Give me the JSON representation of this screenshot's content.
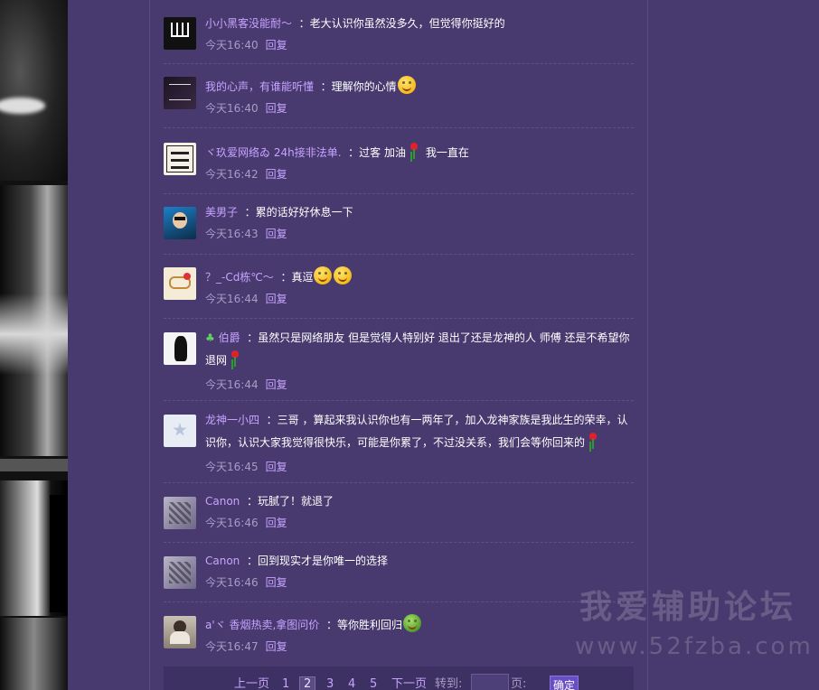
{
  "comments": [
    {
      "user": "小小黑客没能耐～",
      "text": "：老大认识你虽然没多久，但觉得你挺好的",
      "time": "今天16:40",
      "reply": "回复"
    },
    {
      "user": "我的心声，有谁能听懂",
      "text": "：理解你的心情",
      "time": "今天16:40",
      "reply": "回复"
    },
    {
      "user": "ヾ玖爱网络ゐ 24h接非法单.",
      "text": "：过客 加油",
      "text2": "我一直在",
      "time": "今天16:42",
      "reply": "回复"
    },
    {
      "user": "美男子",
      "text": "：累的话好好休息一下",
      "time": "今天16:43",
      "reply": "回复"
    },
    {
      "user": "？_-Cd栋℃～",
      "text": "：真逗",
      "time": "今天16:44",
      "reply": "回复"
    },
    {
      "user": "伯爵",
      "text": "：虽然只是网络朋友 但是觉得人特别好 退出了还是龙神的人 师傅 还是不希望你退网",
      "time": "今天16:44",
      "reply": "回复"
    },
    {
      "user": "龙神一小四",
      "text": "：三哥 ，算起来我认识你也有一两年了，加入龙神家族是我此生的荣幸，认识你，认识大家我觉得很快乐，可能是你累了，不过没关系，我们会等你回来的",
      "time": "今天16:45",
      "reply": "回复"
    },
    {
      "user": "Canon",
      "text": "：玩腻了！就退了",
      "time": "今天16:46",
      "reply": "回复"
    },
    {
      "user": "Canon",
      "text": "：回到现实才是你唯一的选择",
      "time": "今天16:46",
      "reply": "回复"
    },
    {
      "user": "a'ヾ 香烟热卖,拿图问价",
      "text": "：等你胜利回归",
      "time": "今天16:47",
      "reply": "回复"
    }
  ],
  "pager": {
    "prev": "上一页",
    "pages": [
      "1",
      "2",
      "3",
      "4",
      "5"
    ],
    "current": "2",
    "next": "下一页",
    "goto_label": "转到:",
    "page_unit": "页:",
    "confirm": "确定"
  },
  "watermark": {
    "line1": "我爱辅助论坛",
    "line2": "www.52fzba.com"
  },
  "icons": {
    "emoji": "smile-emoji-icon",
    "rose": "rose-icon",
    "clover": "clover-icon",
    "turtle": "turtle-emoji-icon"
  },
  "colors": {
    "background": "#483a6e",
    "username": "#c7a3ff",
    "meta": "#a89cc6",
    "confirm_button": "#6a4fc4"
  }
}
